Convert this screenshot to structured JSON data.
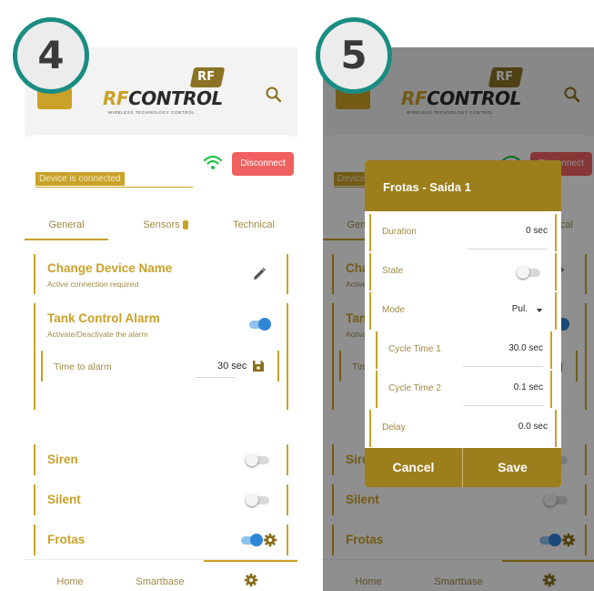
{
  "steps": [
    "4",
    "5"
  ],
  "brand": {
    "mark": "RF",
    "name_prefix": "RF",
    "name_rest": "CONTROL",
    "tagline": "WIRELESS TECHNOLOGY CONTROL"
  },
  "colors": {
    "gold": "#c9a227",
    "dark_gold": "#9c7e1c",
    "red": "#f06060",
    "blue": "#2f86d6",
    "teal": "#1a8d82",
    "green": "#22c24a"
  },
  "device": {
    "status": "Device is connected",
    "disconnect": "Disconnect"
  },
  "tabs": {
    "general": "General",
    "sensors": "Sensors",
    "technical": "Technical"
  },
  "settings": {
    "change_name": {
      "title": "Change Device Name",
      "subtitle": "Active connection required"
    },
    "tank_alarm": {
      "title": "Tank Control Alarm",
      "subtitle": "Activate/Deactivate the alarm",
      "enabled": true
    },
    "time_to_alarm": {
      "label": "Time to alarm",
      "value": "30 sec"
    },
    "siren": {
      "title": "Siren",
      "enabled": false
    },
    "silent": {
      "title": "Silent",
      "enabled": false
    },
    "frotas": {
      "title": "Frotas",
      "enabled": true
    }
  },
  "nav": {
    "home": "Home",
    "smartbase": "Smartbase"
  },
  "dialog": {
    "title": "Frotas - Saída 1",
    "fields": [
      {
        "label": "Duration",
        "value": "0 sec"
      },
      {
        "label": "State",
        "enabled": false
      },
      {
        "label": "Mode",
        "value": "Pul."
      },
      {
        "label": "Cycle Time 1",
        "value": "30.0 sec"
      },
      {
        "label": "Cycle Time 2",
        "value": "0.1 sec"
      },
      {
        "label": "Delay",
        "value": "0.0 sec"
      }
    ],
    "cancel": "Cancel",
    "save": "Save"
  }
}
